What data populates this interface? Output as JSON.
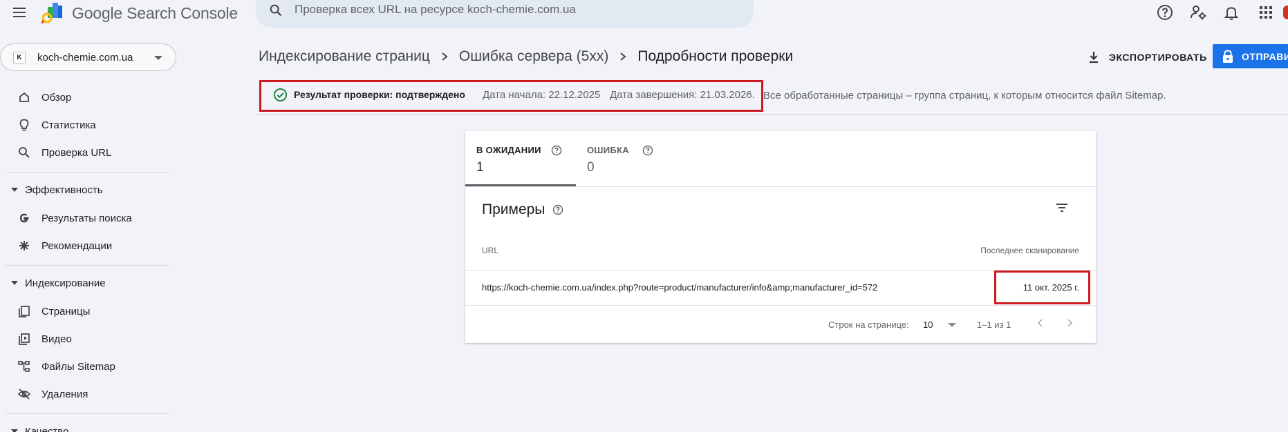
{
  "app": {
    "product_name": "Google Search Console"
  },
  "search": {
    "placeholder": "Проверка всех URL на ресурсе koch-chemie.com.ua"
  },
  "property": {
    "badge": "K",
    "name": "koch-chemie.com.ua"
  },
  "sidebar": {
    "overview": "Обзор",
    "insights": "Статистика",
    "url_inspection": "Проверка URL",
    "performance_section": "Эффективность",
    "search_results": "Результаты поиска",
    "recommendations": "Рекомендации",
    "indexing_section": "Индексирование",
    "pages": "Страницы",
    "videos": "Видео",
    "sitemaps": "Файлы Sitemap",
    "removals": "Удаления",
    "quality_section": "Качество"
  },
  "breadcrumb": {
    "items": [
      "Индексирование страниц",
      "Ошибка сервера (5xx)"
    ],
    "current": "Подробности проверки"
  },
  "actions": {
    "export_label": "ЭКСПОРТИРОВАТЬ",
    "submit_label": "ОТПРАВИТЬ"
  },
  "validation": {
    "result": "Результат проверки: подтверждено",
    "start": "Дата начала: 22.12.2025",
    "end": "Дата завершения: 21.03.2026.",
    "description": "Все обработанные страницы – группа страниц, к которым относится файл Sitemap."
  },
  "tabs": [
    {
      "label": "В ОЖИДАНИИ",
      "count": "1",
      "active": true
    },
    {
      "label": "ОШИБКА",
      "count": "0",
      "active": false
    }
  ],
  "examples": {
    "title": "Примеры",
    "columns": {
      "url": "URL",
      "last_crawled": "Последнее сканирование"
    },
    "rows": [
      {
        "url": "https://koch-chemie.com.ua/index.php?route=product/manufacturer/info&amp;manufacturer_id=572",
        "last_crawled": "11 окт. 2025 г."
      }
    ]
  },
  "pagination": {
    "rows_label": "Строк на странице:",
    "rows_value": "10",
    "range": "1–1 из 1"
  },
  "colors": {
    "accent": "#1a73e8",
    "highlight": "#d0191e",
    "success": "#188038"
  }
}
